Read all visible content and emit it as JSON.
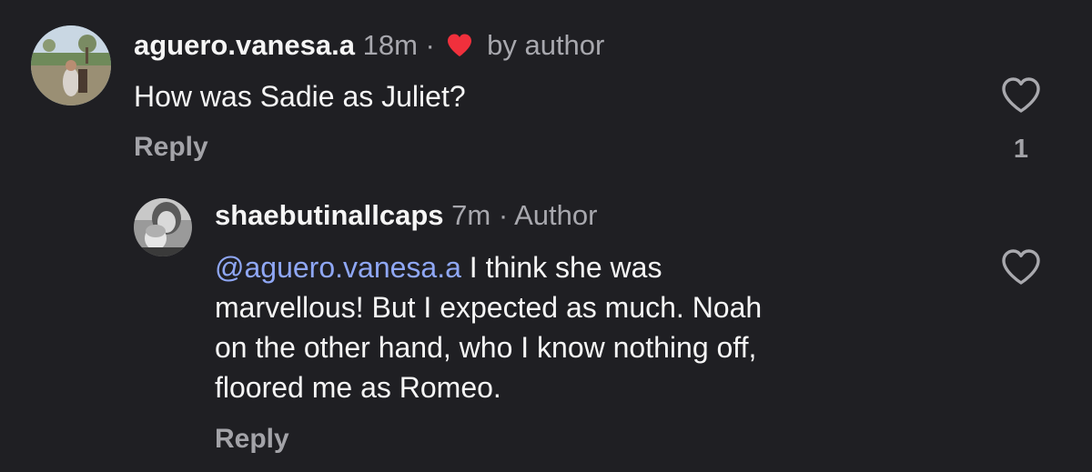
{
  "comments": [
    {
      "username": "aguero.vanesa.a",
      "time": "18m",
      "separator": "·",
      "liked_by_author_icon": "red-heart-icon",
      "liked_by_author_label": "by author",
      "text": "How was Sadie as Juliet?",
      "reply_label": "Reply",
      "like_count": "1",
      "like_icon": "heart-outline-icon",
      "heart_color": "#f0303c"
    },
    {
      "username": "shaebutinallcaps",
      "time": "7m",
      "separator": "·",
      "author_label": "Author",
      "mention": "@aguero.vanesa.a",
      "text_lines": [
        " I think she was",
        "marvellous! But I expected as much. Noah",
        "on the other hand, who I know nothing off,",
        "floored me as Romeo."
      ],
      "reply_label": "Reply",
      "like_icon": "heart-outline-icon"
    }
  ],
  "colors": {
    "background": "#1f1f23",
    "primary_text": "#f5f5f5",
    "secondary_text": "#a8a8ae",
    "mention": "#8fa7f5"
  }
}
